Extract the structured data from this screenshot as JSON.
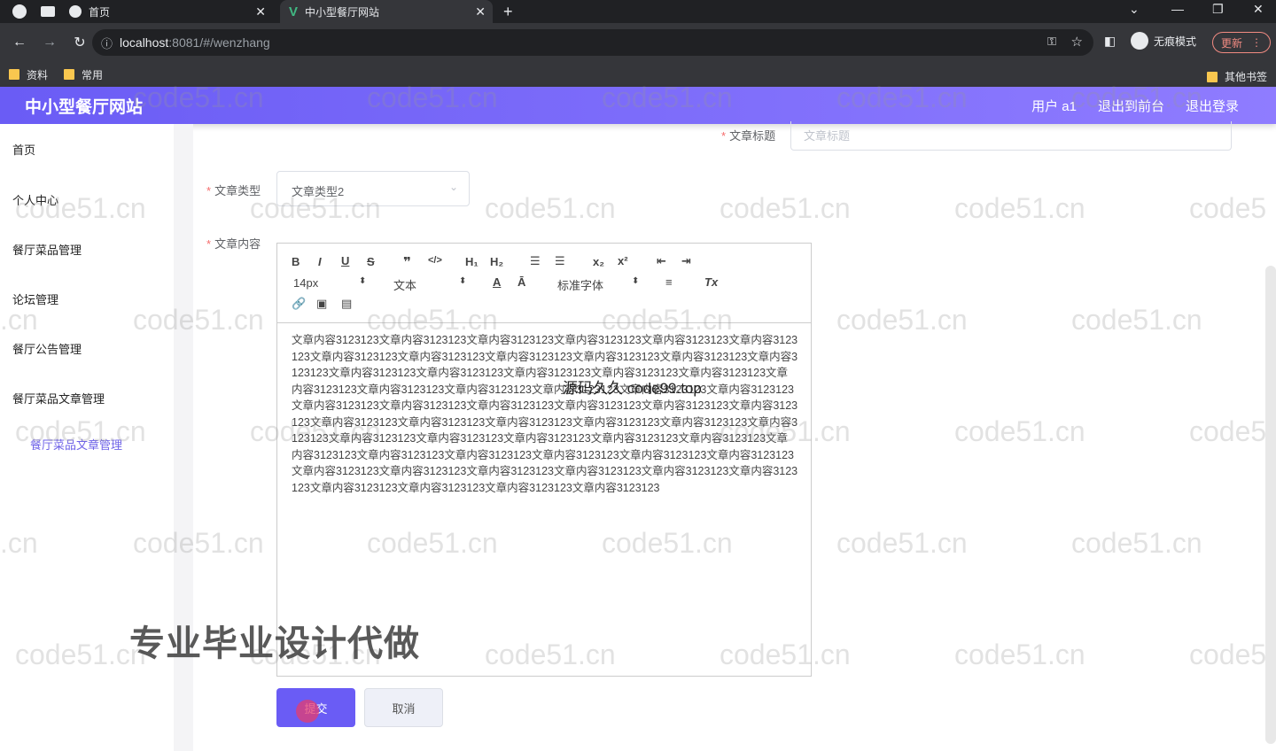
{
  "browser": {
    "tabs": [
      {
        "label": "首页"
      },
      {
        "label": "中小型餐厅网站"
      }
    ],
    "url_host": "localhost",
    "url_rest": ":8081/#/wenzhang",
    "incognito_label": "无痕模式",
    "update_label": "更新",
    "bookmarks": [
      "资料",
      "常用"
    ],
    "other_bookmarks": "其他书签"
  },
  "header": {
    "title": "中小型餐厅网站",
    "user": "用户 a1",
    "exit_front": "退出到前台",
    "logout": "退出登录"
  },
  "sidebar": {
    "items": [
      "首页",
      "个人中心",
      "餐厅菜品管理",
      "论坛管理",
      "餐厅公告管理",
      "餐厅菜品文章管理"
    ],
    "sub_item": "餐厅菜品文章管理"
  },
  "form": {
    "title_label": "文章标题",
    "title_placeholder": "文章标题",
    "type_label": "文章类型",
    "type_value": "文章类型2",
    "content_label": "文章内容",
    "font_size": "14px",
    "block_type": "文本",
    "font_family": "标准字体",
    "content": "文章内容3123123文章内容3123123文章内容3123123文章内容3123123文章内容3123123文章内容3123123文章内容3123123文章内容3123123文章内容3123123文章内容3123123文章内容3123123文章内容3123123文章内容3123123文章内容3123123文章内容3123123文章内容3123123文章内容3123123文章内容3123123文章内容3123123文章内容3123123文章内容3123123文章内容3123123文章内容3123123文章内容3123123文章内容3123123文章内容3123123文章内容3123123文章内容3123123文章内容3123123文章内容3123123文章内容3123123文章内容3123123文章内容3123123文章内容3123123文章内容3123123文章内容3123123文章内容3123123文章内容3123123文章内容3123123文章内容3123123文章内容3123123文章内容3123123文章内容3123123文章内容3123123文章内容3123123文章内容3123123文章内容3123123文章内容3123123文章内容3123123文章内容3123123文章内容3123123文章内容3123123文章内容3123123文章内容3123123文章内容3123123文章内容3123123",
    "submit": "提交",
    "cancel": "取消"
  },
  "watermarks": {
    "site": "code51.cn",
    "site_tail": "code5",
    "site_cut": ".cn",
    "mid": "源码久久 code99.top",
    "promo": "专业毕业设计代做"
  }
}
